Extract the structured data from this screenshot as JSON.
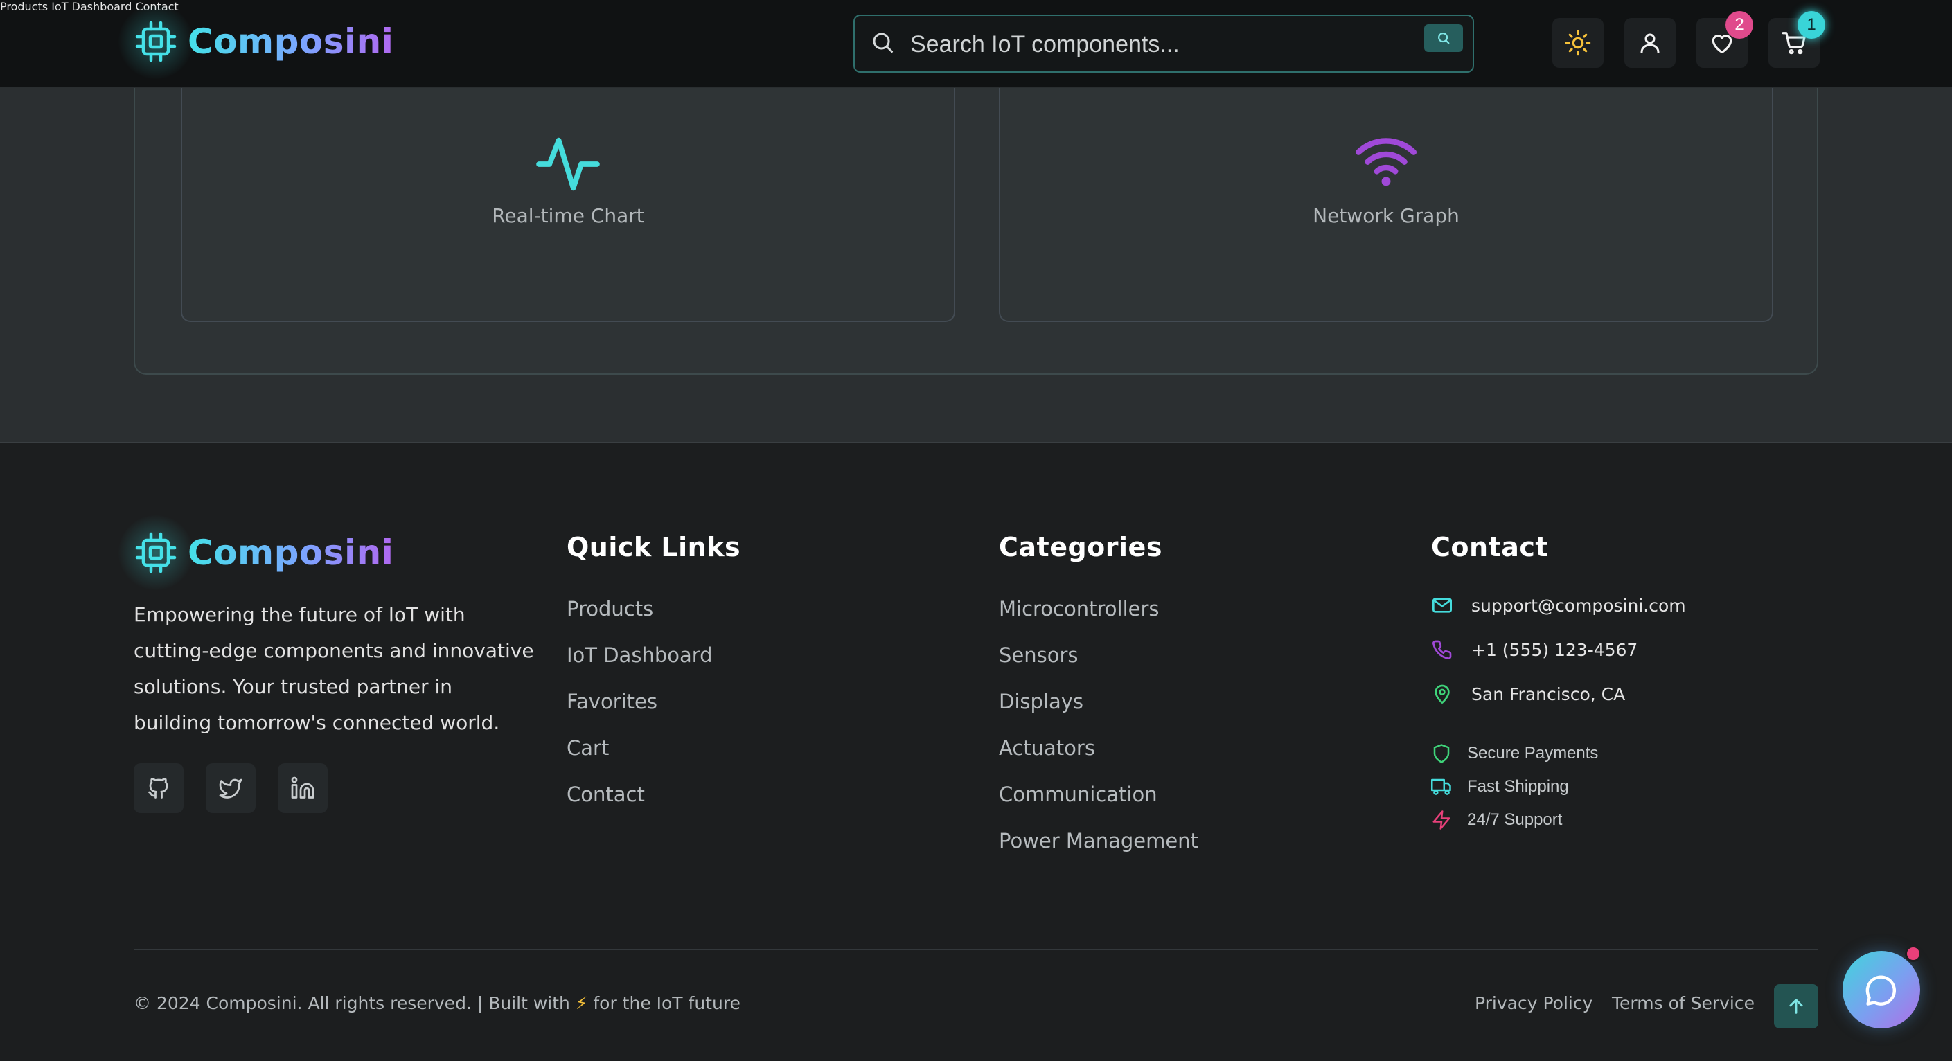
{
  "brand": {
    "name": "Composini"
  },
  "header": {
    "nav": [
      "Products",
      "IoT Dashboard",
      "Contact"
    ],
    "search": {
      "placeholder": "Search IoT components...",
      "value": ""
    },
    "actions": {
      "theme_icon": "sun-icon",
      "account_icon": "user-icon",
      "favorites_count": "2",
      "cart_count": "1"
    }
  },
  "widgets": [
    {
      "label": "Real-time Chart",
      "icon": "activity-icon",
      "color": "#45dcdc"
    },
    {
      "label": "Network Graph",
      "icon": "wifi-icon",
      "color": "#a049d8"
    }
  ],
  "footer": {
    "about": "Empowering the future of IoT with cutting-edge components and innovative solutions. Your trusted partner in building tomorrow's connected world.",
    "socials": [
      "github-icon",
      "twitter-icon",
      "linkedin-icon"
    ],
    "quick_links": {
      "title": "Quick Links",
      "items": [
        "Products",
        "IoT Dashboard",
        "Favorites",
        "Cart",
        "Contact"
      ]
    },
    "categories": {
      "title": "Categories",
      "items": [
        "Microcontrollers",
        "Sensors",
        "Displays",
        "Actuators",
        "Communication",
        "Power Management"
      ]
    },
    "contact": {
      "title": "Contact",
      "email": "support@composini.com",
      "phone": "+1 (555) 123-4567",
      "location": "San Francisco, CA"
    },
    "features": [
      "Secure Payments",
      "Fast Shipping",
      "24/7 Support"
    ],
    "copyright_prefix": "© 2024 Composini. All rights reserved. | Built with",
    "copyright_bolt": "⚡",
    "copyright_suffix": "for the IoT future",
    "legal": [
      "Privacy Policy",
      "Terms of Service"
    ]
  },
  "colors": {
    "accent_cyan": "#45e1e8",
    "accent_purple": "#b068f0",
    "favorites_badge": "#e04a8c",
    "chat_dot": "#e8407a"
  }
}
